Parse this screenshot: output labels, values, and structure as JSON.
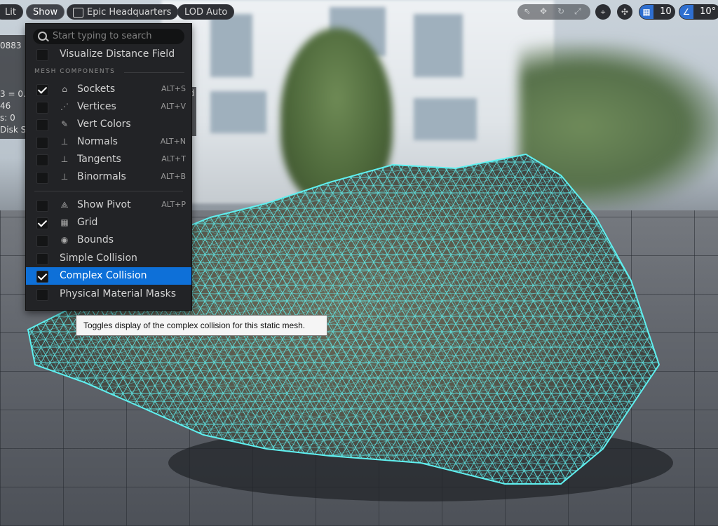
{
  "toolbar": {
    "view_mode": "Lit",
    "show_label": "Show",
    "environment": "Epic Headquarters",
    "lod": "LOD Auto",
    "grid_snap_value": "10",
    "rotation_snap_value": "10°",
    "accent_color": "#2f6fd0"
  },
  "stats": {
    "lines": [
      "0883",
      "",
      "",
      "3 = 0.",
      "46",
      "s: 0",
      "Disk S"
    ],
    "right_fragment": "d"
  },
  "show_menu": {
    "search_placeholder": "Start typing to search",
    "top_items": [
      {
        "label": "Visualize Distance Field",
        "checked": false
      }
    ],
    "section_title": "MESH COMPONENTS",
    "mesh_items": [
      {
        "label": "Sockets",
        "shortcut": "ALT+S",
        "checked": true,
        "icon": "sockets-icon"
      },
      {
        "label": "Vertices",
        "shortcut": "ALT+V",
        "checked": false,
        "icon": "vertices-icon"
      },
      {
        "label": "Vert Colors",
        "shortcut": "",
        "checked": false,
        "icon": "vert-colors-icon"
      },
      {
        "label": "Normals",
        "shortcut": "ALT+N",
        "checked": false,
        "icon": "normals-icon"
      },
      {
        "label": "Tangents",
        "shortcut": "ALT+T",
        "checked": false,
        "icon": "tangents-icon"
      },
      {
        "label": "Binormals",
        "shortcut": "ALT+B",
        "checked": false,
        "icon": "binormals-icon"
      }
    ],
    "other_items": [
      {
        "label": "Show Pivot",
        "shortcut": "ALT+P",
        "checked": false,
        "icon": "pivot-icon"
      },
      {
        "label": "Grid",
        "shortcut": "",
        "checked": true,
        "icon": "grid-icon"
      },
      {
        "label": "Bounds",
        "shortcut": "",
        "checked": false,
        "icon": "bounds-icon"
      },
      {
        "label": "Simple Collision",
        "shortcut": "",
        "checked": false,
        "icon": ""
      },
      {
        "label": "Complex Collision",
        "shortcut": "",
        "checked": true,
        "icon": "",
        "selected": true
      },
      {
        "label": "Physical Material Masks",
        "shortcut": "",
        "checked": false,
        "icon": ""
      }
    ]
  },
  "tooltip": {
    "text": "Toggles display of the complex collision for this static mesh."
  }
}
